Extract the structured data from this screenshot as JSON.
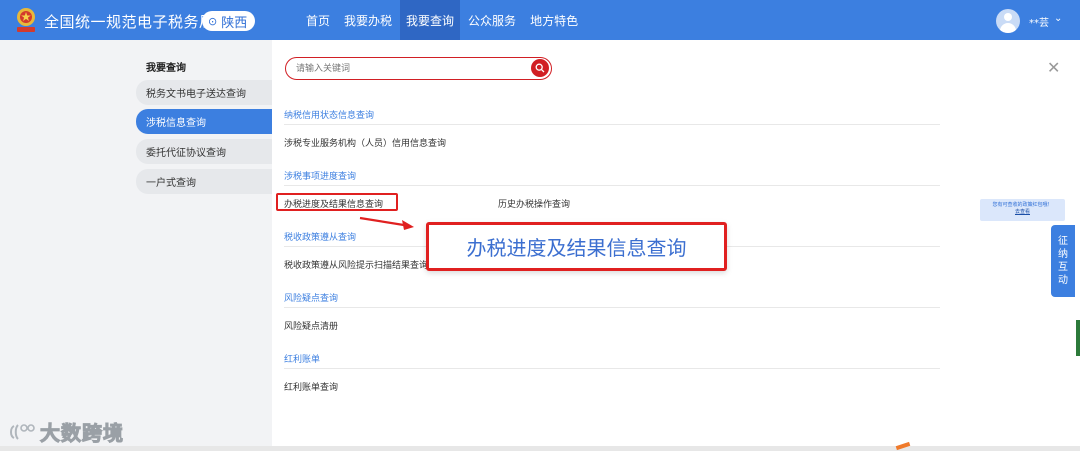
{
  "header": {
    "site_title": "全国统一规范电子税务局",
    "region": "陕西",
    "nav": [
      "首页",
      "我要办税",
      "我要查询",
      "公众服务",
      "地方特色"
    ],
    "nav_active_index": 2,
    "user_name": "**芸"
  },
  "sidebar": {
    "title": "我要查询",
    "items": [
      "税务文书电子送达查询",
      "涉税信息查询",
      "委托代征协议查询",
      "一户式查询"
    ],
    "active_index": 1
  },
  "search": {
    "placeholder": "请输入关键词"
  },
  "sections": [
    {
      "heading": "纳税信用状态信息查询",
      "items": [
        "涉税专业服务机构（人员）信用信息查询"
      ]
    },
    {
      "heading": "涉税事项进度查询",
      "items": [
        "办税进度及结果信息查询",
        "历史办税操作查询"
      ]
    },
    {
      "heading": "税收政策遵从查询",
      "items": [
        "税收政策遵从风险提示扫描结果查询"
      ]
    },
    {
      "heading": "风险疑点查询",
      "items": [
        "风险疑点清册"
      ]
    },
    {
      "heading": "红利账单",
      "items": [
        "红利账单查询"
      ]
    }
  ],
  "callout": {
    "text": "办税进度及结果信息查询"
  },
  "right_float": {
    "tip_text": "您有可查收的政策红包哦！",
    "tip_link": "去查看",
    "tab_label": "征纳互动"
  },
  "watermark": {
    "text": "大数跨境"
  },
  "colors": {
    "primary": "#3c7fe0",
    "nav_active": "#2f67c4",
    "highlight_red": "#e02020",
    "search_red": "#d11f24"
  }
}
